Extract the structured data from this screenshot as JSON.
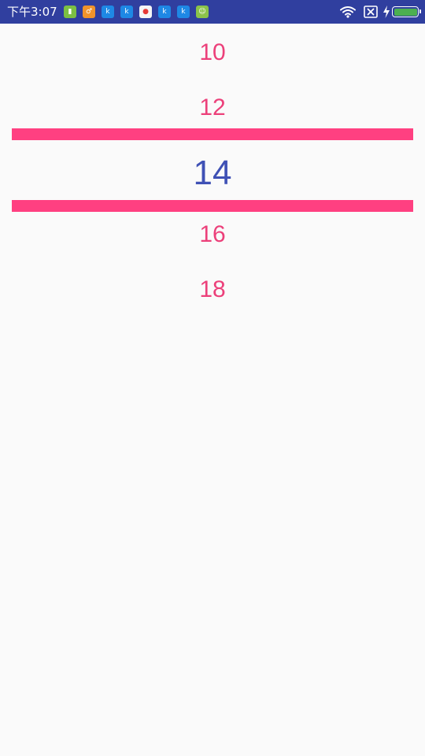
{
  "status_bar": {
    "time": "下午3:07",
    "background": "#303f9f",
    "notification_icons": [
      {
        "name": "memo-app-icon",
        "color": "#7cc043",
        "glyph": "▮"
      },
      {
        "name": "carrot-app-icon",
        "color": "#f0932b",
        "glyph": "♂"
      },
      {
        "name": "app-notification-icon-1",
        "color": "#1e88e5",
        "glyph": "k"
      },
      {
        "name": "app-notification-icon-2",
        "color": "#1e88e5",
        "glyph": "k"
      },
      {
        "name": "maps-app-icon",
        "color": "#f5f5f5",
        "glyph": "●"
      },
      {
        "name": "app-notification-icon-3",
        "color": "#1e88e5",
        "glyph": "k"
      },
      {
        "name": "app-notification-icon-4",
        "color": "#1e88e5",
        "glyph": "k"
      },
      {
        "name": "android-debug-icon",
        "color": "#8bc34a",
        "glyph": "☺"
      }
    ],
    "battery_color": "#4caf50"
  },
  "picker": {
    "items": [
      "10",
      "12",
      "14",
      "16",
      "18"
    ],
    "selected_index": 2,
    "unselected_color": "#ec407a",
    "selected_color": "#3f51b5",
    "divider_color": "#ff4081"
  }
}
